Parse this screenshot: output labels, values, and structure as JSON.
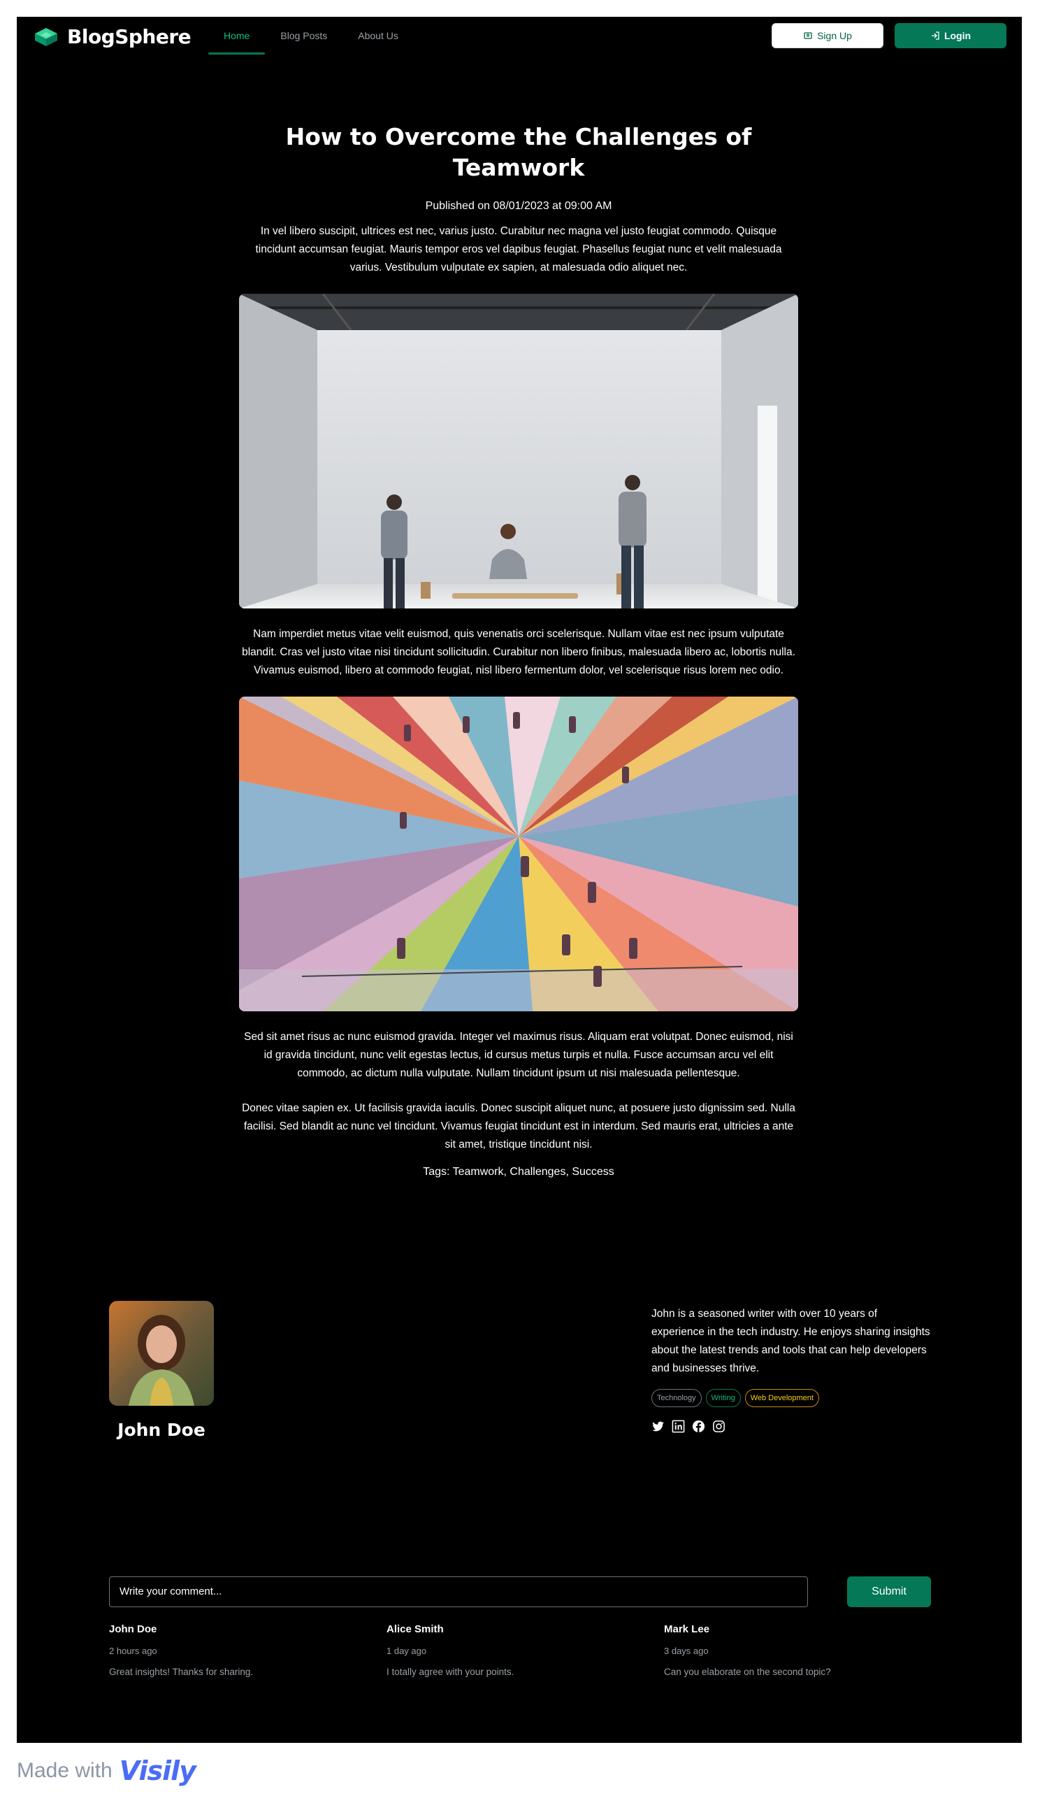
{
  "brand": {
    "name": "BlogSphere",
    "accent": "#047857",
    "accent_light": "#10b981"
  },
  "nav": [
    {
      "label": "Home",
      "active": true
    },
    {
      "label": "Blog Posts",
      "active": false
    },
    {
      "label": "About Us",
      "active": false
    }
  ],
  "actions": {
    "signup_label": "Sign Up",
    "login_label": "Login"
  },
  "article": {
    "title": "How to Overcome the Challenges of Teamwork",
    "published": "Published on 08/01/2023 at 09:00 AM",
    "paragraphs": [
      "In vel libero suscipit, ultrices est nec, varius justo. Curabitur nec magna vel justo feugiat commodo. Quisque tincidunt accumsan feugiat. Mauris tempor eros vel dapibus feugiat. Phasellus feugiat nunc et velit malesuada varius. Vestibulum vulputate ex sapien, at malesuada odio aliquet nec.",
      "Nam imperdiet metus vitae velit euismod, quis venenatis orci scelerisque. Nullam vitae est nec ipsum vulputate blandit. Cras vel justo vitae nisi tincidunt sollicitudin. Curabitur non libero finibus, malesuada libero ac, lobortis nulla. Vivamus euismod, libero at commodo feugiat, nisl libero fermentum dolor, vel scelerisque risus lorem nec odio.",
      "Sed sit amet risus ac nunc euismod gravida. Integer vel maximus risus. Aliquam erat volutpat. Donec euismod, nisi id gravida tincidunt, nunc velit egestas lectus, id cursus metus turpis et nulla. Fusce accumsan arcu vel elit commodo, ac dictum nulla vulputate. Nullam tincidunt ipsum ut nisi malesuada pellentesque.",
      "Donec vitae sapien ex. Ut facilisis gravida iaculis. Donec suscipit aliquet nunc, at posuere justo dignissim sed. Nulla facilisi. Sed blandit ac nunc vel tincidunt. Vivamus feugiat tincidunt est in interdum. Sed mauris erat, ultricies a ante sit amet, tristique tincidunt nisi."
    ],
    "tags": "Tags: Teamwork, Challenges, Success"
  },
  "author": {
    "name": "John Doe",
    "bio": "John is a seasoned writer with over 10 years of experience in the tech industry. He enjoys sharing insights about the latest trends and tools that can help developers and businesses thrive.",
    "topics": [
      "Technology",
      "Writing",
      "Web Development"
    ],
    "socials": [
      "twitter-icon",
      "linkedin-icon",
      "facebook-icon",
      "instagram-icon"
    ]
  },
  "comment_form": {
    "placeholder": "Write your comment...",
    "submit_label": "Submit"
  },
  "comments": [
    {
      "name": "John Doe",
      "time": "2 hours ago",
      "text": "Great insights! Thanks for sharing."
    },
    {
      "name": "Alice Smith",
      "time": "1 day ago",
      "text": "I totally agree with your points."
    },
    {
      "name": "Mark Lee",
      "time": "3 days ago",
      "text": "Can you elaborate on the second topic?"
    }
  ],
  "watermark": {
    "prefix": "Made with",
    "brand": "Visily"
  }
}
